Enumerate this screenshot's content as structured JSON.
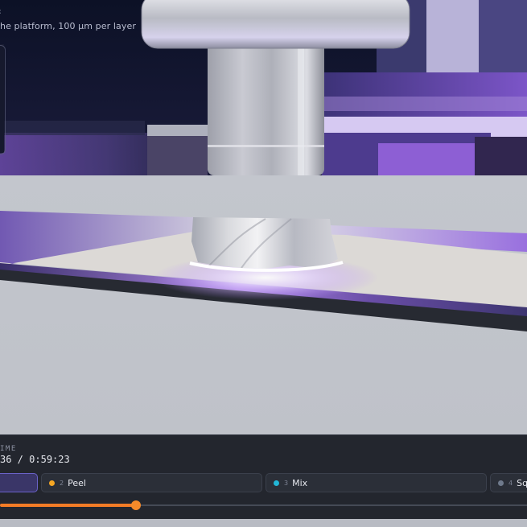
{
  "caption": {
    "text": "he platform, 100 µm per layer",
    "arrow_glyph": "‹"
  },
  "timeline": {
    "label": "IME",
    "current": "36",
    "separator": " / ",
    "total": "0:59:23",
    "progress": 0.258
  },
  "steps": [
    {
      "number": "",
      "name": "",
      "dot_color": "",
      "active": true
    },
    {
      "number": "2",
      "name": "Peel",
      "dot_color": "#f5a623",
      "active": false
    },
    {
      "number": "3",
      "name": "Mix",
      "dot_color": "#22b6d6",
      "active": false
    },
    {
      "number": "4",
      "name": "Squ",
      "dot_color": "#6f7a8c",
      "active": false
    }
  ],
  "colors": {
    "accent": "#f37c26",
    "active_step": "#6a62c8",
    "uv_glow": "#b585ff",
    "bar_bg": "#23262e"
  }
}
